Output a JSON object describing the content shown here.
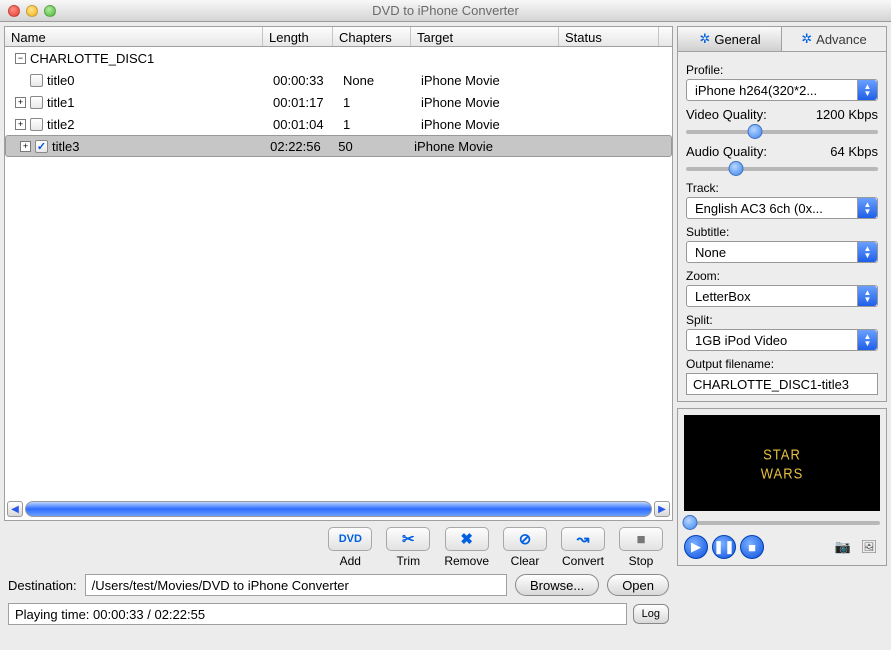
{
  "window": {
    "title": "DVD to iPhone Converter"
  },
  "columns": {
    "name": "Name",
    "length": "Length",
    "chapters": "Chapters",
    "target": "Target",
    "status": "Status"
  },
  "rows": [
    {
      "type": "disc",
      "label": "CHARLOTTE_DISC1"
    },
    {
      "type": "title",
      "checked": false,
      "expandable": false,
      "label": "title0",
      "length": "00:00:33",
      "chapters": "None",
      "target": "iPhone Movie"
    },
    {
      "type": "title",
      "checked": false,
      "expandable": true,
      "label": "title1",
      "length": "00:01:17",
      "chapters": "1",
      "target": "iPhone Movie"
    },
    {
      "type": "title",
      "checked": false,
      "expandable": true,
      "label": "title2",
      "length": "00:01:04",
      "chapters": "1",
      "target": "iPhone Movie"
    },
    {
      "type": "title",
      "checked": true,
      "expandable": true,
      "label": "title3",
      "length": "02:22:56",
      "chapters": "50",
      "target": "iPhone Movie",
      "selected": true
    }
  ],
  "toolbar": {
    "add": "Add",
    "trim": "Trim",
    "remove": "Remove",
    "clear": "Clear",
    "convert": "Convert",
    "stop": "Stop"
  },
  "dest": {
    "label": "Destination:",
    "path": "/Users/test/Movies/DVD to iPhone Converter",
    "browse": "Browse...",
    "open": "Open"
  },
  "status": {
    "text": "Playing time: 00:00:33 / 02:22:55",
    "log": "Log"
  },
  "tabs": {
    "general": "General",
    "advance": "Advance"
  },
  "profile": {
    "label": "Profile:",
    "value": "iPhone h264(320*2..."
  },
  "vq": {
    "label": "Video Quality:",
    "value": "1200 Kbps",
    "pos": 36
  },
  "aq": {
    "label": "Audio Quality:",
    "value": "64 Kbps",
    "pos": 26
  },
  "track": {
    "label": "Track:",
    "value": "English AC3 6ch (0x..."
  },
  "subtitle": {
    "label": "Subtitle:",
    "value": "None"
  },
  "zoom": {
    "label": "Zoom:",
    "value": "LetterBox"
  },
  "split": {
    "label": "Split:",
    "value": "1GB iPod Video"
  },
  "output": {
    "label": "Output filename:",
    "value": "CHARLOTTE_DISC1-title3"
  },
  "preview": {
    "logo_top": "STAR",
    "logo_bottom": "WARS",
    "pos": 3
  }
}
